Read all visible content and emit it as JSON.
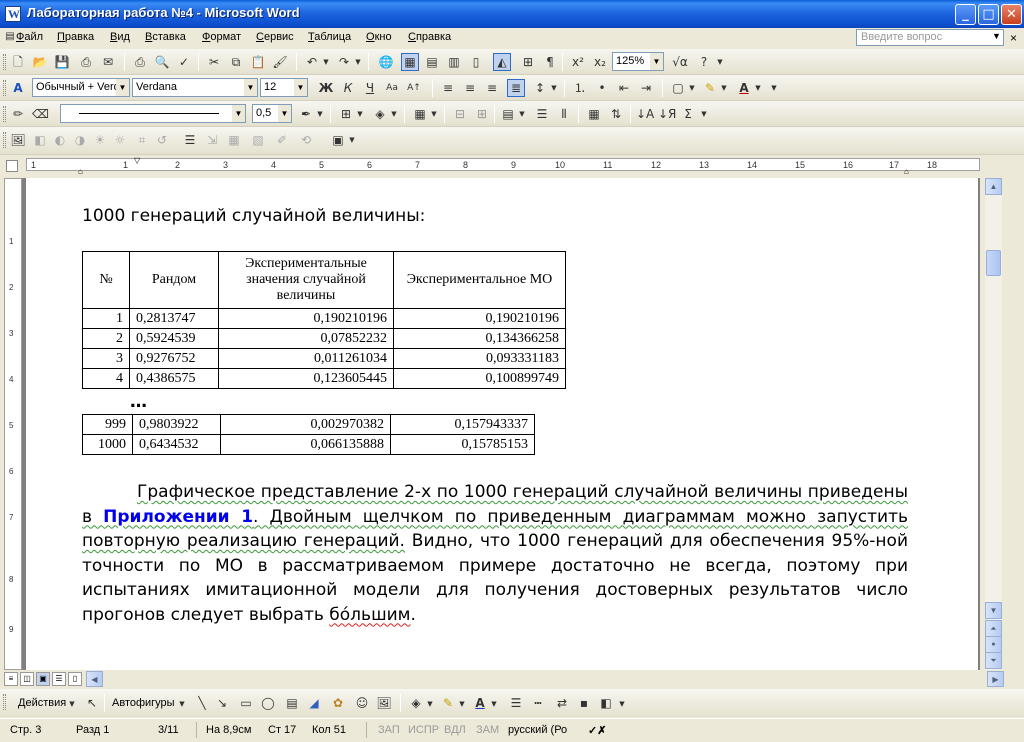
{
  "window": {
    "title": "Лабораторная работа №4 - Microsoft Word",
    "controls": {
      "minimize": "_",
      "maximize": "□",
      "close": "✕"
    }
  },
  "menu": {
    "items": [
      "Файл",
      "Правка",
      "Вид",
      "Вставка",
      "Формат",
      "Сервис",
      "Таблица",
      "Окно",
      "Справка"
    ],
    "help_placeholder": "Введите вопрос"
  },
  "toolbar": {
    "zoom": "125%",
    "style": "Обычный + Verd",
    "font": "Verdana",
    "size": "12",
    "line_width": "0,5"
  },
  "ruler": {
    "h_numbers": [
      "1",
      "1",
      "2",
      "3",
      "4",
      "5",
      "6",
      "7",
      "8",
      "9",
      "10",
      "11",
      "12",
      "13",
      "14",
      "15",
      "16",
      "17",
      "18"
    ],
    "v_numbers": [
      "1",
      "2",
      "3",
      "4",
      "5",
      "6",
      "7",
      "8",
      "9"
    ]
  },
  "document": {
    "heading": "1000 генераций случайной величины:",
    "table1": {
      "headers": [
        "№",
        "Рандом",
        "Экспериментальные значения случайной величины",
        "Экспериментальное МО"
      ],
      "rows": [
        [
          "1",
          "0,2813747",
          "0,190210196",
          "0,190210196"
        ],
        [
          "2",
          "0,5924539",
          "0,07852232",
          "0,134366258"
        ],
        [
          "3",
          "0,9276752",
          "0,011261034",
          "0,093331183"
        ],
        [
          "4",
          "0,4386575",
          "0,123605445",
          "0,100899749"
        ]
      ]
    },
    "ellipsis": "…",
    "table2": {
      "rows": [
        [
          "999",
          "0,9803922",
          "0,002970382",
          "0,157943337"
        ],
        [
          "1000",
          "0,6434532",
          "0,066135888",
          "0,15785153"
        ]
      ]
    },
    "paragraph": {
      "part1": "Графическое представление 2-х по 1000 генераций случайной величины приведены в ",
      "link": "Приложении 1",
      "part2": ". Двойным щелчком по приведенным диаграммам можно запустить повторную реализацию генераций.",
      "part3": " Видно, что 1000 генераций для обеспечения 95%-ной точности по МО в рассматриваемом примере достаточно не всегда, поэтому при испытаниях имитационной модели для получения достоверных результатов число прогонов следует выбрать ",
      "misspelled": "бóльшим",
      "end": "."
    }
  },
  "drawing_toolbar": {
    "actions": "Действия",
    "autoshapes": "Автофигуры"
  },
  "status": {
    "page": "Стр. 3",
    "section": "Разд 1",
    "pages": "3/11",
    "position": "На 8,9см",
    "line": "Ст 17",
    "col": "Кол 51",
    "rec": "ЗАП",
    "trk": "ИСПР",
    "ext": "ВДЛ",
    "ovr": "ЗАМ",
    "language": "русский (Ро"
  },
  "colors": {
    "titlebar": "#0d4fd0",
    "link": "#0000ee",
    "grammar_underline": "#3a9a3a",
    "spelling_underline": "#e02020"
  }
}
